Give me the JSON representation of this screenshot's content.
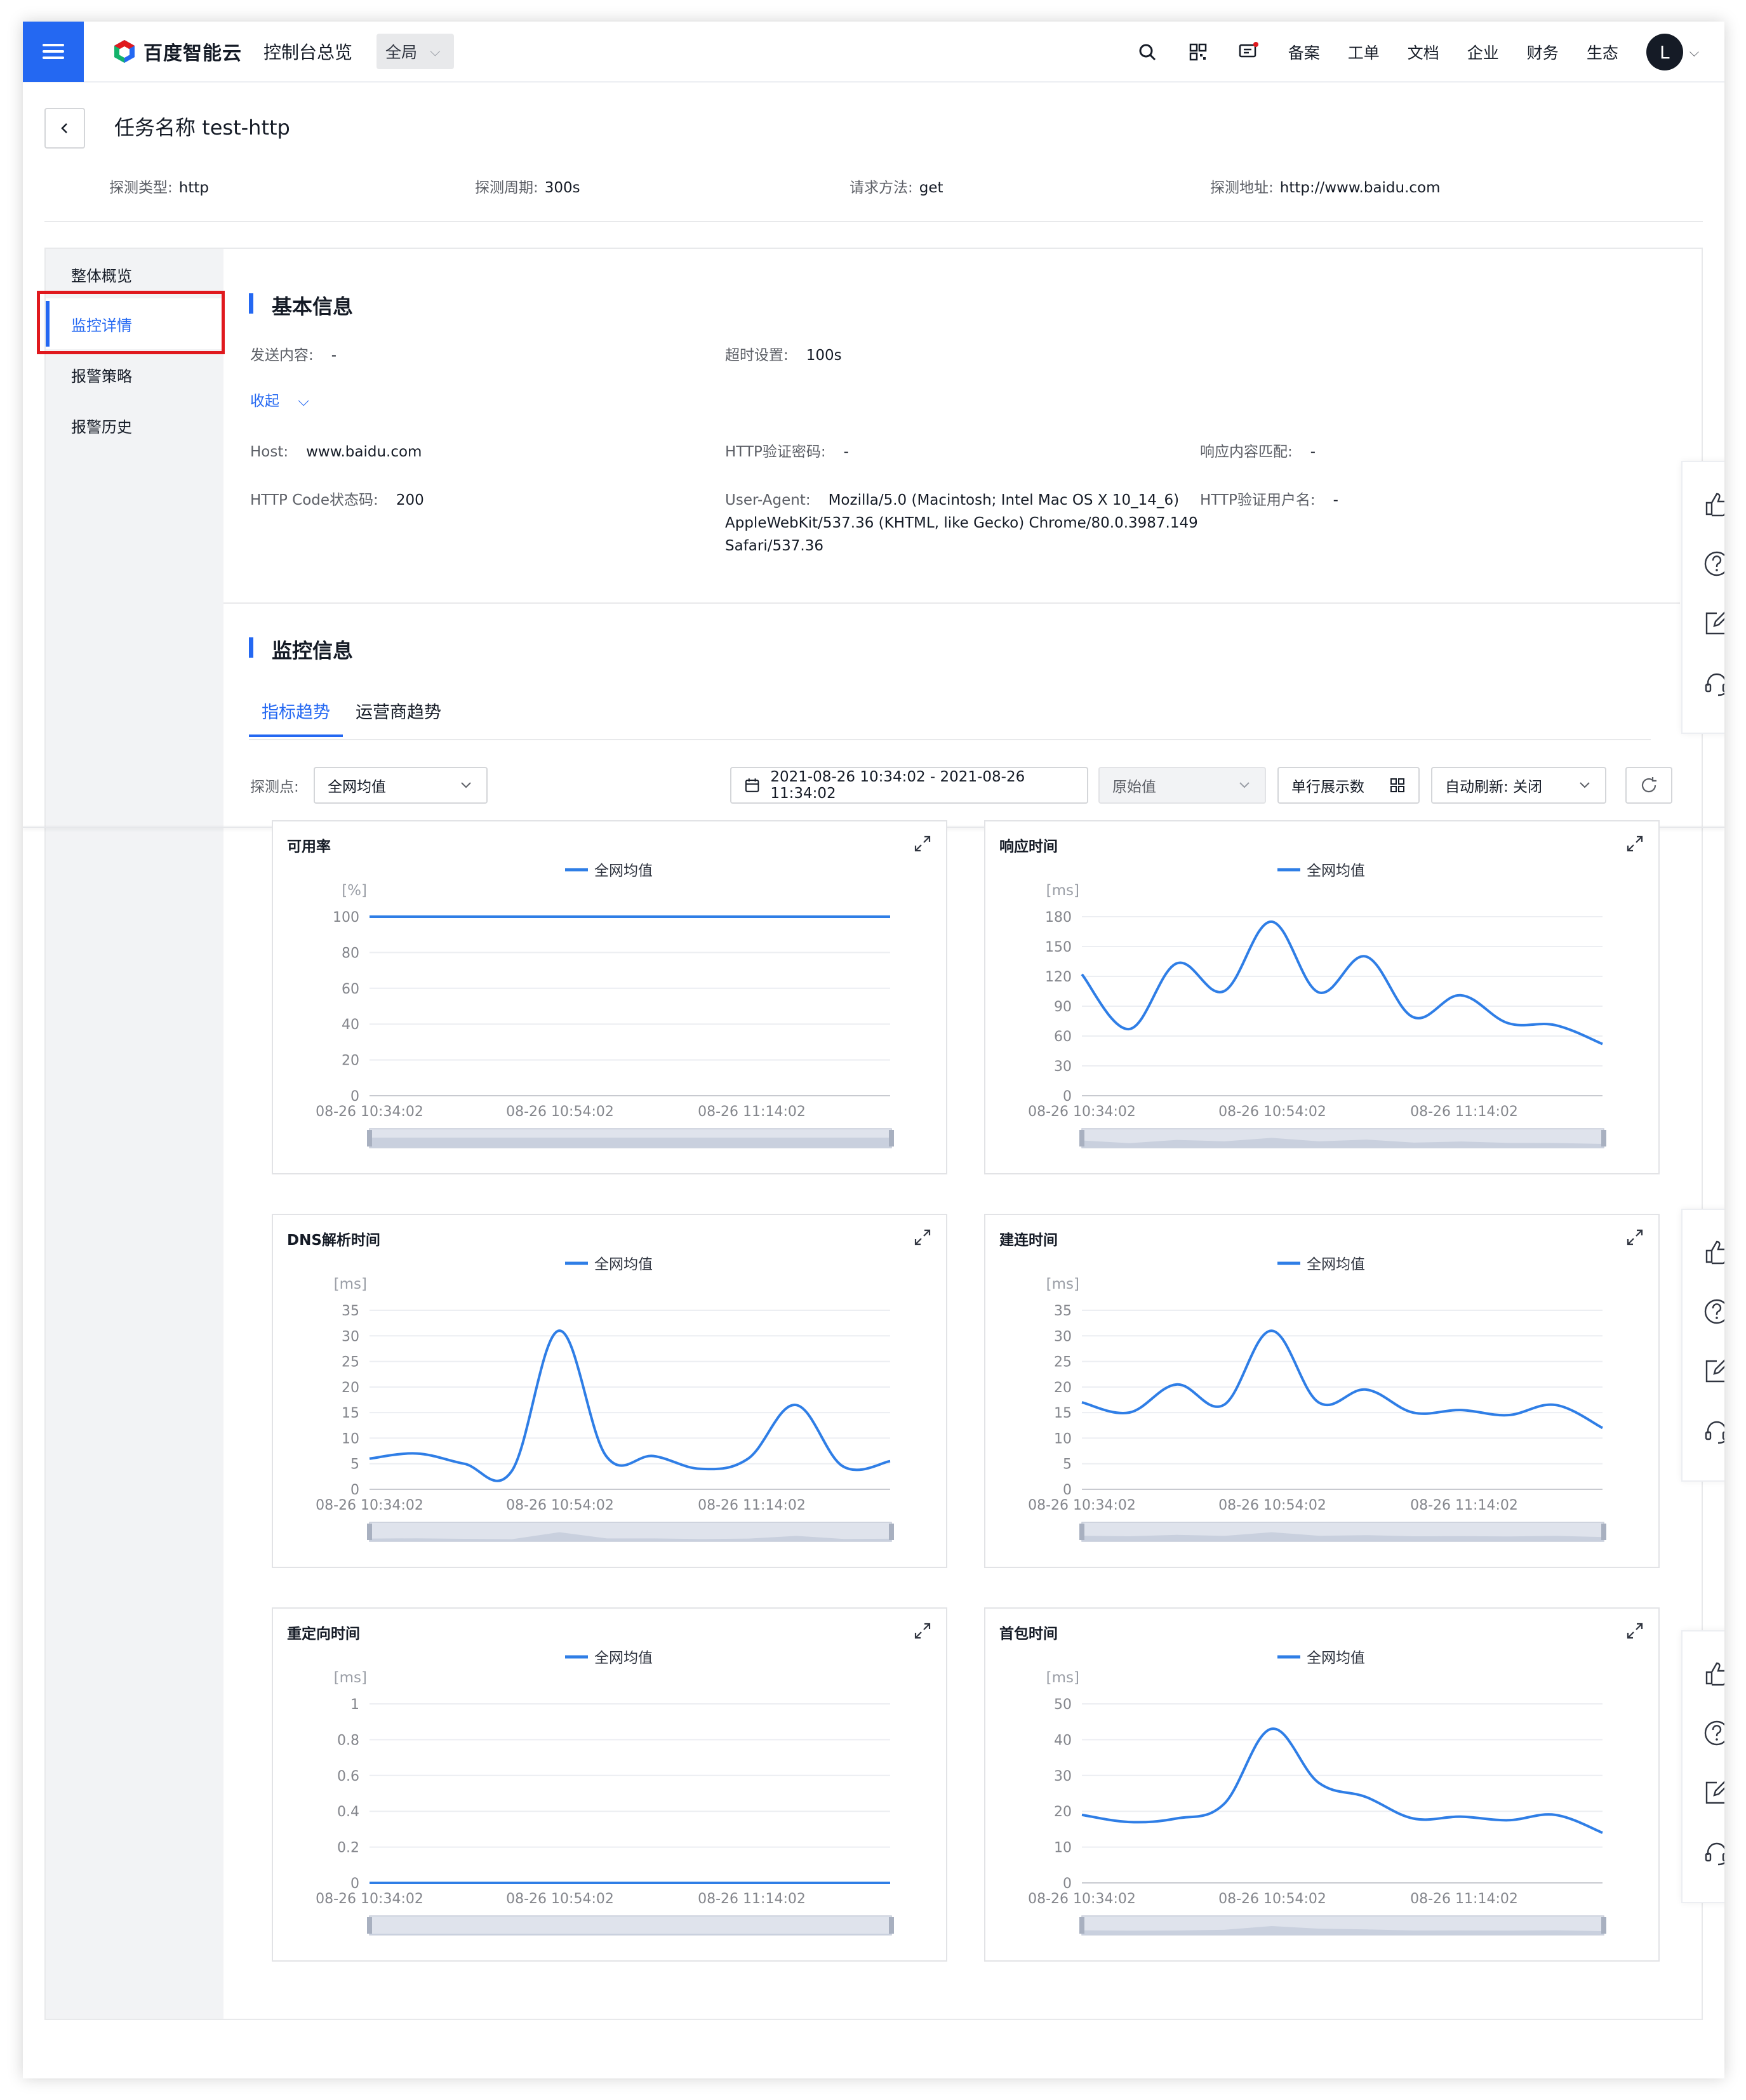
{
  "topbar": {
    "brand": "百度智能云",
    "console_label": "控制台总览",
    "region": "全局",
    "links": [
      "备案",
      "工单",
      "文档",
      "企业",
      "财务",
      "生态"
    ],
    "avatar_letter": "L"
  },
  "task": {
    "title": "任务名称 test-http",
    "meta": [
      {
        "key": "探测类型:",
        "value": "http"
      },
      {
        "key": "探测周期:",
        "value": "300s"
      },
      {
        "key": "请求方法:",
        "value": "get"
      },
      {
        "key": "探测地址:",
        "value": "http://www.baidu.com"
      }
    ]
  },
  "sidebar": {
    "items": [
      {
        "label": "整体概览"
      },
      {
        "label": "监控详情",
        "active": true
      },
      {
        "label": "报警策略"
      },
      {
        "label": "报警历史"
      }
    ]
  },
  "basic_info": {
    "title": "基本信息",
    "send_content": {
      "key": "发送内容:",
      "value": "-"
    },
    "timeout": {
      "key": "超时设置:",
      "value": "100s"
    },
    "collapse_label": "收起",
    "host": {
      "key": "Host:",
      "value": "www.baidu.com"
    },
    "http_password": {
      "key": "HTTP验证密码:",
      "value": "-"
    },
    "response_match": {
      "key": "响应内容匹配:",
      "value": "-"
    },
    "http_code": {
      "key": "HTTP Code状态码:",
      "value": "200"
    },
    "user_agent": {
      "key": "User-Agent:",
      "value_line1": "Mozilla/5.0 (Macintosh; Intel Mac OS X 10_14_6)",
      "value_line2": "AppleWebKit/537.36 (KHTML, like Gecko) Chrome/80.0.3987.149",
      "value_line3": "Safari/537.36"
    },
    "http_user": {
      "key": "HTTP验证用户名:",
      "value": "-"
    }
  },
  "monitor": {
    "title": "监控信息",
    "tabs": [
      {
        "label": "指标趋势",
        "active": true
      },
      {
        "label": "运营商趋势"
      }
    ],
    "probe_label": "探测点:",
    "probe_value": "全网均值",
    "time_range": "2021-08-26 10:34:02 - 2021-08-26 11:34:02",
    "value_type": "原始值",
    "per_row_label": "单行展示数",
    "auto_refresh": "自动刷新: 关闭"
  },
  "colors": {
    "accent": "#2468f2",
    "line": "#2f7ee6",
    "highlight_box": "#e0191e"
  },
  "chart_data": [
    {
      "type": "line",
      "title": "可用率",
      "unit": "[%]",
      "legend": "全网均值",
      "yticks": [
        "100",
        "80",
        "60",
        "40",
        "20",
        "0"
      ],
      "ylim": [
        0,
        100
      ],
      "xticks": [
        "08-26 10:34:02",
        "08-26 10:54:02",
        "08-26 11:14:02"
      ],
      "series": [
        {
          "name": "全网均值",
          "values": [
            100,
            100,
            100,
            100,
            100,
            100,
            100,
            100,
            100,
            100,
            100,
            100
          ]
        }
      ]
    },
    {
      "type": "line",
      "title": "响应时间",
      "unit": "[ms]",
      "legend": "全网均值",
      "yticks": [
        "180",
        "150",
        "120",
        "90",
        "60",
        "30",
        "0"
      ],
      "ylim": [
        0,
        180
      ],
      "xticks": [
        "08-26 10:34:02",
        "08-26 10:54:02",
        "08-26 11:14:02"
      ],
      "series": [
        {
          "name": "全网均值",
          "values": [
            122,
            67,
            133,
            105,
            175,
            104,
            140,
            79,
            101,
            73,
            71,
            52
          ]
        }
      ]
    },
    {
      "type": "line",
      "title": "DNS解析时间",
      "unit": "[ms]",
      "legend": "全网均值",
      "yticks": [
        "35",
        "30",
        "25",
        "20",
        "15",
        "10",
        "5",
        "0"
      ],
      "ylim": [
        0,
        35
      ],
      "xticks": [
        "08-26 10:34:02",
        "08-26 10:54:02",
        "08-26 11:14:02"
      ],
      "series": [
        {
          "name": "全网均值",
          "values": [
            6,
            7,
            5,
            3.5,
            31,
            6.5,
            6.5,
            4,
            6,
            16.5,
            4.5,
            5.5
          ]
        }
      ]
    },
    {
      "type": "line",
      "title": "建连时间",
      "unit": "[ms]",
      "legend": "全网均值",
      "yticks": [
        "35",
        "30",
        "25",
        "20",
        "15",
        "10",
        "5",
        "0"
      ],
      "ylim": [
        0,
        35
      ],
      "xticks": [
        "08-26 10:34:02",
        "08-26 10:54:02",
        "08-26 11:14:02"
      ],
      "series": [
        {
          "name": "全网均值",
          "values": [
            17,
            15,
            20.5,
            16.5,
            31,
            17,
            19.5,
            15,
            15.5,
            14.5,
            16.5,
            12
          ]
        }
      ]
    },
    {
      "type": "line",
      "title": "重定向时间",
      "unit": "[ms]",
      "legend": "全网均值",
      "yticks": [
        "1",
        "0.8",
        "0.6",
        "0.4",
        "0.2",
        "0"
      ],
      "ylim": [
        0,
        1
      ],
      "xticks": [
        "08-26 10:34:02",
        "08-26 10:54:02",
        "08-26 11:14:02"
      ],
      "series": [
        {
          "name": "全网均值",
          "values": [
            0,
            0,
            0,
            0,
            0,
            0,
            0,
            0,
            0,
            0,
            0,
            0
          ]
        }
      ]
    },
    {
      "type": "line",
      "title": "首包时间",
      "unit": "[ms]",
      "legend": "全网均值",
      "yticks": [
        "50",
        "40",
        "30",
        "20",
        "10",
        "0"
      ],
      "ylim": [
        0,
        50
      ],
      "xticks": [
        "08-26 10:34:02",
        "08-26 10:54:02",
        "08-26 11:14:02"
      ],
      "series": [
        {
          "name": "全网均值",
          "values": [
            19,
            17,
            18,
            22,
            43,
            28,
            24,
            18,
            18.5,
            17.5,
            19,
            14
          ]
        }
      ]
    }
  ],
  "float_tool_icons": [
    "thumbs-up-icon",
    "help-icon",
    "edit-icon",
    "headset-icon"
  ]
}
